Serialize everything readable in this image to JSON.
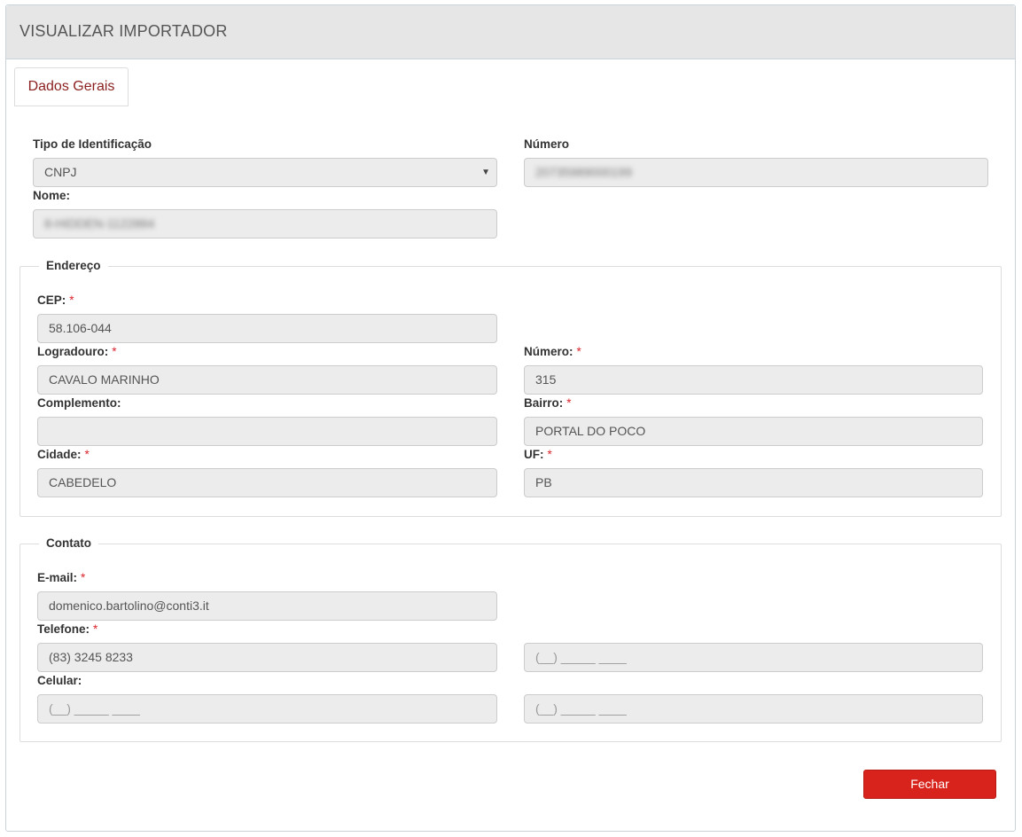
{
  "header": {
    "title": "VISUALIZAR IMPORTADOR"
  },
  "tabs": {
    "dados_gerais": "Dados Gerais"
  },
  "identificacao": {
    "tipo_label": "Tipo de Identificação",
    "tipo_value": "CNPJ",
    "numero_label": "Número",
    "numero_value": "20735989000199",
    "nome_label": "Nome:",
    "nome_value": "8-HIDDEN-1122884"
  },
  "endereco": {
    "legend": "Endereço",
    "required_mark": "*",
    "cep_label": "CEP:",
    "cep_value": "58.106-044",
    "logradouro_label": "Logradouro:",
    "logradouro_value": "CAVALO MARINHO",
    "numero_label": "Número:",
    "numero_value": "315",
    "complemento_label": "Complemento:",
    "complemento_value": "",
    "bairro_label": "Bairro:",
    "bairro_value": "PORTAL DO POCO",
    "cidade_label": "Cidade:",
    "cidade_value": "CABEDELO",
    "uf_label": "UF:",
    "uf_value": "PB"
  },
  "contato": {
    "legend": "Contato",
    "email_label": "E-mail:",
    "email_value": "domenico.bartolino@conti3.it",
    "telefone_label": "Telefone:",
    "telefone_value": "(83) 3245 8233",
    "telefone2_value": "(__) _____ ____",
    "celular_label": "Celular:",
    "celular_value": "(__) _____ ____",
    "celular2_value": "(__) _____ ____"
  },
  "actions": {
    "fechar": "Fechar"
  }
}
